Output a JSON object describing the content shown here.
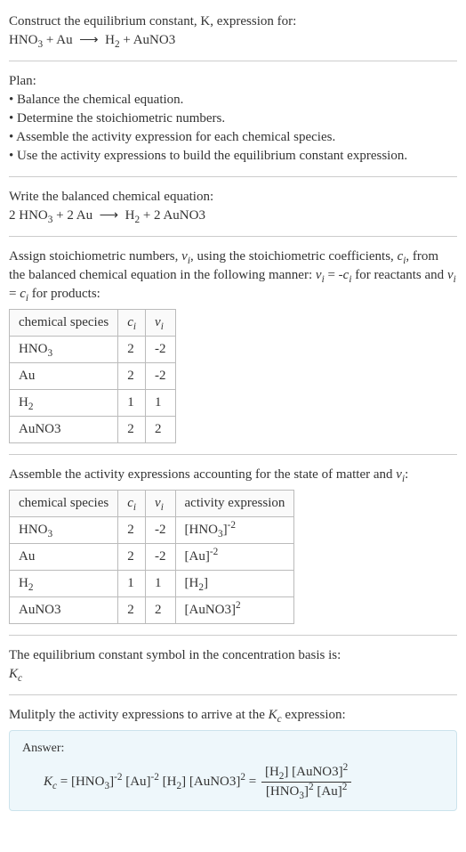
{
  "header": {
    "line1": "Construct the equilibrium constant, K, expression for:",
    "equation": "HNO₃ + Au ⟶ H₂ + AuNO3"
  },
  "plan": {
    "title": "Plan:",
    "b1": "• Balance the chemical equation.",
    "b2": "• Determine the stoichiometric numbers.",
    "b3": "• Assemble the activity expression for each chemical species.",
    "b4": "• Use the activity expressions to build the equilibrium constant expression."
  },
  "balanced": {
    "intro": "Write the balanced chemical equation:",
    "equation": "2 HNO₃ + 2 Au ⟶ H₂ + 2 AuNO3"
  },
  "stoich": {
    "intro": "Assign stoichiometric numbers, νᵢ, using the stoichiometric coefficients, cᵢ, from the balanced chemical equation in the following manner: νᵢ = -cᵢ for reactants and νᵢ = cᵢ for products:",
    "h_species": "chemical species",
    "h_ci": "cᵢ",
    "h_vi": "νᵢ",
    "r1": {
      "s": "HNO₃",
      "c": "2",
      "v": "-2"
    },
    "r2": {
      "s": "Au",
      "c": "2",
      "v": "-2"
    },
    "r3": {
      "s": "H₂",
      "c": "1",
      "v": "1"
    },
    "r4": {
      "s": "AuNO3",
      "c": "2",
      "v": "2"
    }
  },
  "activity": {
    "intro": "Assemble the activity expressions accounting for the state of matter and νᵢ:",
    "h_species": "chemical species",
    "h_ci": "cᵢ",
    "h_vi": "νᵢ",
    "h_act": "activity expression",
    "r1": {
      "s": "HNO₃",
      "c": "2",
      "v": "-2",
      "a": "[HNO₃]⁻²"
    },
    "r2": {
      "s": "Au",
      "c": "2",
      "v": "-2",
      "a": "[Au]⁻²"
    },
    "r3": {
      "s": "H₂",
      "c": "1",
      "v": "1",
      "a": "[H₂]"
    },
    "r4": {
      "s": "AuNO3",
      "c": "2",
      "v": "2",
      "a": "[AuNO3]²"
    }
  },
  "symbol": {
    "line1": "The equilibrium constant symbol in the concentration basis is:",
    "line2": "K_c"
  },
  "final": {
    "intro": "Mulitply the activity expressions to arrive at the K_c expression:",
    "answer_label": "Answer:",
    "lhs": "K_c = [HNO₃]⁻² [Au]⁻² [H₂] [AuNO3]² = ",
    "num": "[H₂] [AuNO3]²",
    "den": "[HNO₃]² [Au]²"
  }
}
